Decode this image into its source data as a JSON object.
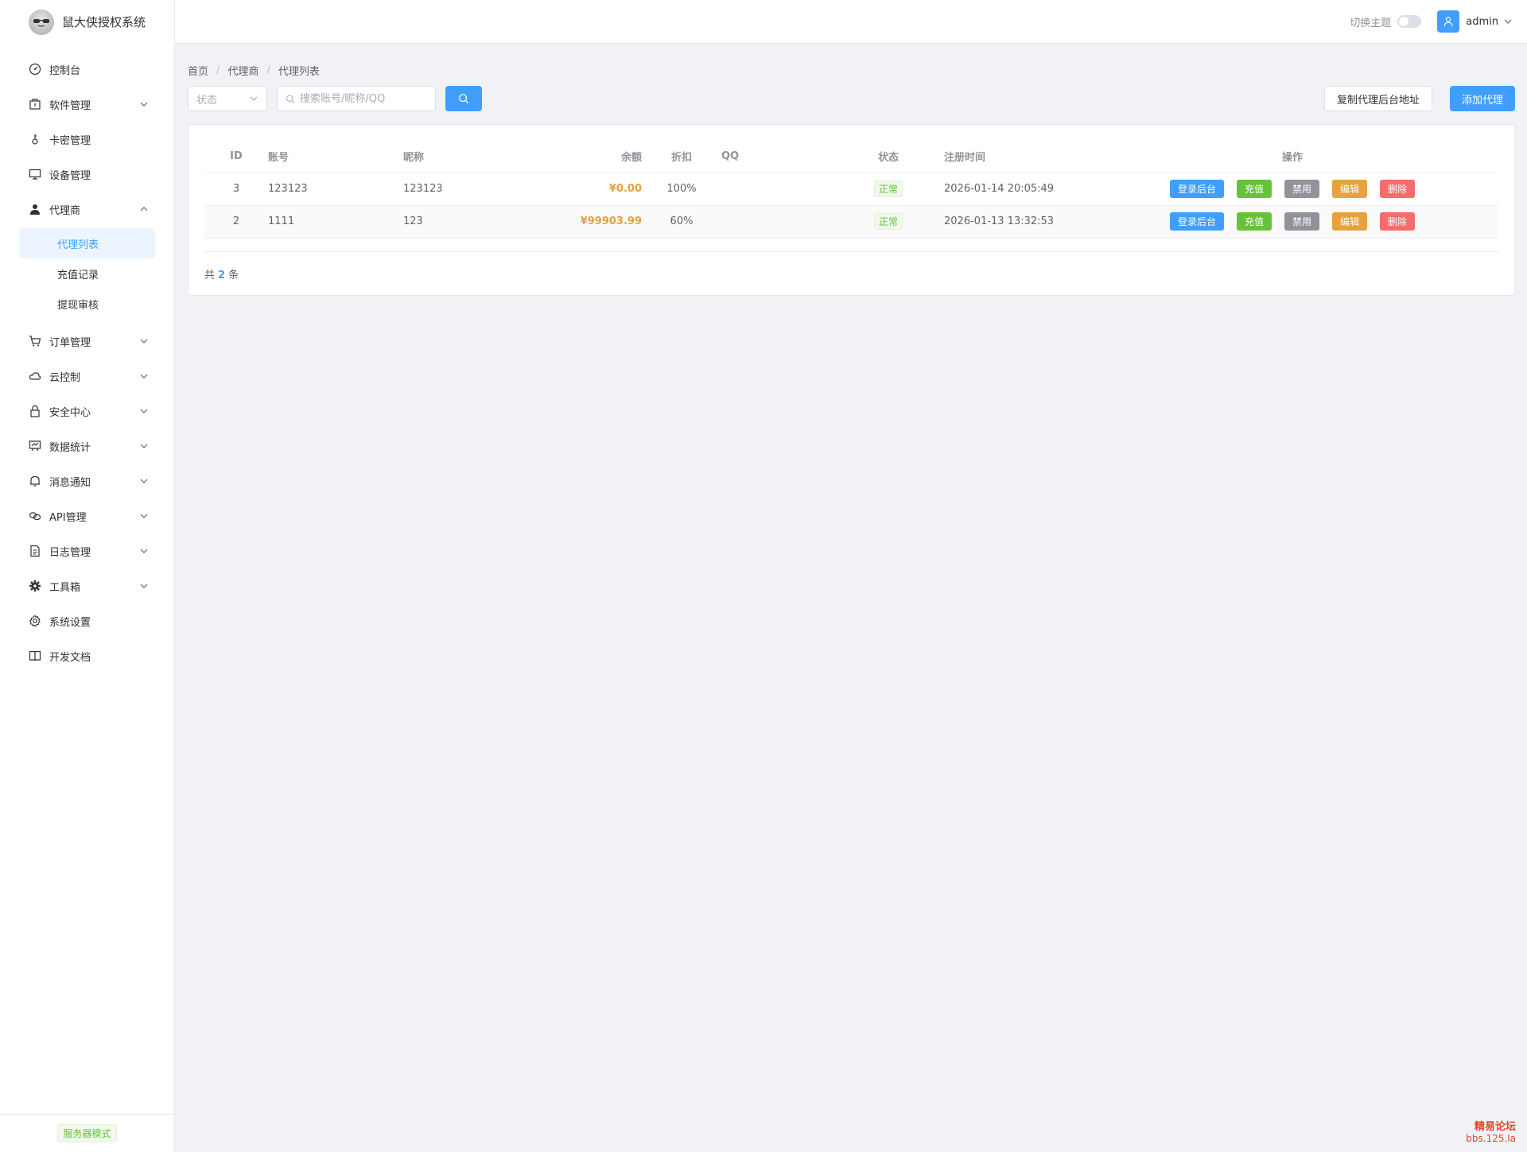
{
  "app": {
    "name": "鼠大侠授权系统",
    "logo_icon": "logo-icon"
  },
  "sidebar": {
    "items": [
      {
        "label": "控制台",
        "icon": "dashboard-icon",
        "has_children": false
      },
      {
        "label": "软件管理",
        "icon": "package-icon",
        "has_children": true
      },
      {
        "label": "卡密管理",
        "icon": "key-icon",
        "has_children": false
      },
      {
        "label": "设备管理",
        "icon": "monitor-icon",
        "has_children": false
      },
      {
        "label": "代理商",
        "icon": "user-icon",
        "has_children": true,
        "expanded": true,
        "children": [
          {
            "label": "代理列表",
            "active": true
          },
          {
            "label": "充值记录",
            "active": false
          },
          {
            "label": "提现审核",
            "active": false
          }
        ]
      },
      {
        "label": "订单管理",
        "icon": "cart-icon",
        "has_children": true
      },
      {
        "label": "云控制",
        "icon": "cloud-icon",
        "has_children": true
      },
      {
        "label": "安全中心",
        "icon": "lock-icon",
        "has_children": true
      },
      {
        "label": "数据统计",
        "icon": "chart-board-icon",
        "has_children": true
      },
      {
        "label": "消息通知",
        "icon": "bell-icon",
        "has_children": true
      },
      {
        "label": "API管理",
        "icon": "link-icon",
        "has_children": true
      },
      {
        "label": "日志管理",
        "icon": "document-icon",
        "has_children": true
      },
      {
        "label": "工具箱",
        "icon": "gear-solid-icon",
        "has_children": true
      },
      {
        "label": "系统设置",
        "icon": "settings-icon",
        "has_children": false
      },
      {
        "label": "开发文档",
        "icon": "book-icon",
        "has_children": false
      }
    ],
    "footer_badge": "服务器模式"
  },
  "header": {
    "theme_label": "切换主题",
    "user_name": "admin"
  },
  "breadcrumb": [
    "首页",
    "代理商",
    "代理列表"
  ],
  "toolbar": {
    "status_placeholder": "状态",
    "search_placeholder": "搜索账号/昵称/QQ",
    "copy_button": "复制代理后台地址",
    "add_button": "添加代理"
  },
  "table": {
    "columns": [
      "ID",
      "账号",
      "昵称",
      "余额",
      "折扣",
      "QQ",
      "状态",
      "注册时间",
      "操作"
    ],
    "rows": [
      {
        "id": "3",
        "account": "123123",
        "nickname": "123123",
        "balance": "¥0.00",
        "discount": "100%",
        "qq": "",
        "status": "正常",
        "registered": "2026-01-14 20:05:49"
      },
      {
        "id": "2",
        "account": "1111",
        "nickname": "123",
        "balance": "¥99903.99",
        "discount": "60%",
        "qq": "",
        "status": "正常",
        "registered": "2026-01-13 13:32:53"
      }
    ],
    "actions": [
      "登录后台",
      "充值",
      "禁用",
      "编辑",
      "删除"
    ]
  },
  "pagination": {
    "prefix": "共",
    "count": "2",
    "suffix": "条"
  },
  "watermark": {
    "title": "精易论坛",
    "url": "bbs.125.la"
  },
  "colors": {
    "primary": "#409eff",
    "success": "#67c23a",
    "warning": "#e6a23c",
    "danger": "#f56c6c",
    "info": "#909399"
  }
}
